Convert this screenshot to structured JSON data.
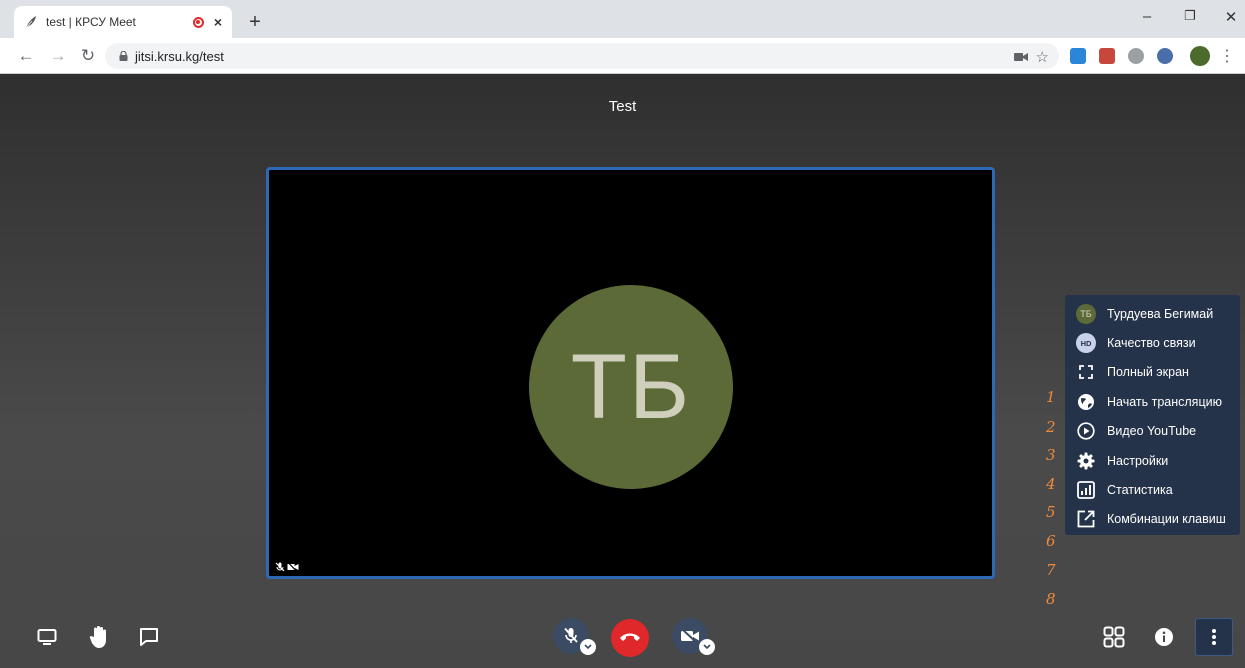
{
  "browser": {
    "tab_title": "test | КРСУ Meet",
    "tab_close": "×",
    "new_tab": "+",
    "url": "jitsi.krsu.kg/test",
    "window_controls": {
      "minimize": "–",
      "restore": "❐",
      "close": "✕"
    }
  },
  "meeting": {
    "title": "Test",
    "participant_initials": "ТБ",
    "avatar_color": "#5b6a36",
    "accent_border": "#2e69b8"
  },
  "menu": {
    "items": [
      {
        "label": "Турдуева Бегимай",
        "icon": "avatar-icon",
        "avatar_text": "ТБ"
      },
      {
        "label": "Качество связи",
        "icon": "hd-icon",
        "badge": "HD"
      },
      {
        "label": "Полный экран",
        "icon": "fullscreen-icon"
      },
      {
        "label": "Начать трансляцию",
        "icon": "globe-icon"
      },
      {
        "label": "Видео YouTube",
        "icon": "play-circle-icon"
      },
      {
        "label": "Настройки",
        "icon": "gear-icon"
      },
      {
        "label": "Статистика",
        "icon": "stats-icon"
      },
      {
        "label": "Комбинации клавиш",
        "icon": "shortcut-icon"
      }
    ]
  },
  "annotations": [
    "1",
    "2",
    "3",
    "4",
    "5",
    "6",
    "7",
    "8"
  ],
  "colors": {
    "hangup": "#e0282b",
    "menu_bg": "#25334a",
    "annotation": "#f08a3a"
  }
}
